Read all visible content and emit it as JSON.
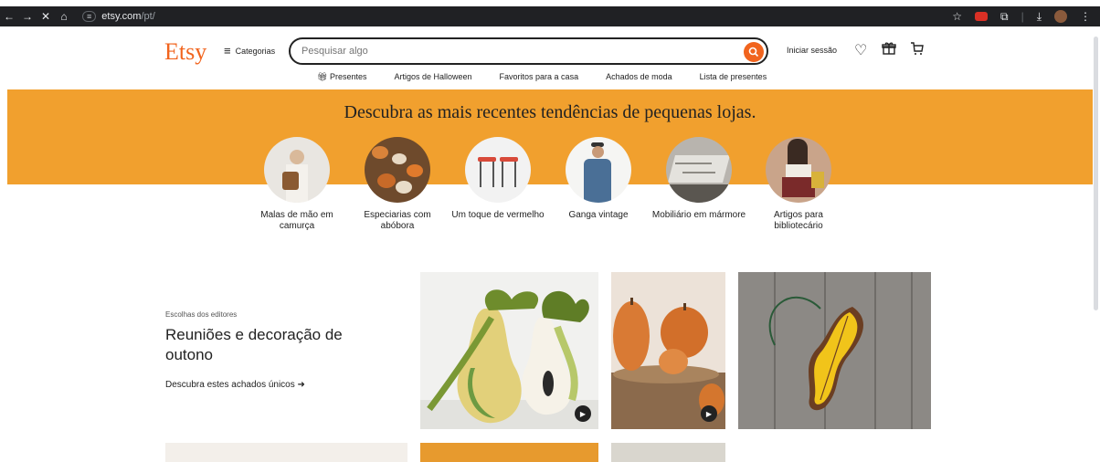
{
  "browser": {
    "back": "←",
    "forward": "→",
    "close": "✕",
    "home": "⌂",
    "site_icon": "≡",
    "host": "etsy.com",
    "path": "/pt/"
  },
  "header": {
    "logo": "Etsy",
    "categories_label": "Categorias",
    "search_placeholder": "Pesquisar algo",
    "signin_label": "Iniciar sessão"
  },
  "subnav": {
    "presents": "Presentes",
    "halloween": "Artigos de Halloween",
    "home_favs": "Favoritos para a casa",
    "fashion": "Achados de moda",
    "gift_list": "Lista de presentes"
  },
  "banner": {
    "title": "Descubra as mais recentes tendências de pequenas lojas.",
    "items": [
      {
        "label": "Malas de mão em camurça"
      },
      {
        "label": "Especiarias com abóbora"
      },
      {
        "label": "Um toque de vermelho"
      },
      {
        "label": "Ganga vintage"
      },
      {
        "label": "Mobiliário em mármore"
      },
      {
        "label": "Artigos para bibliotecário"
      }
    ]
  },
  "editors": {
    "eyebrow": "Escolhas dos editores",
    "title": "Reuniões e decoração de outono",
    "link": "Descubra estes achados únicos"
  },
  "colors": {
    "brand": "#f1641e",
    "banner": "#f1a02e"
  }
}
